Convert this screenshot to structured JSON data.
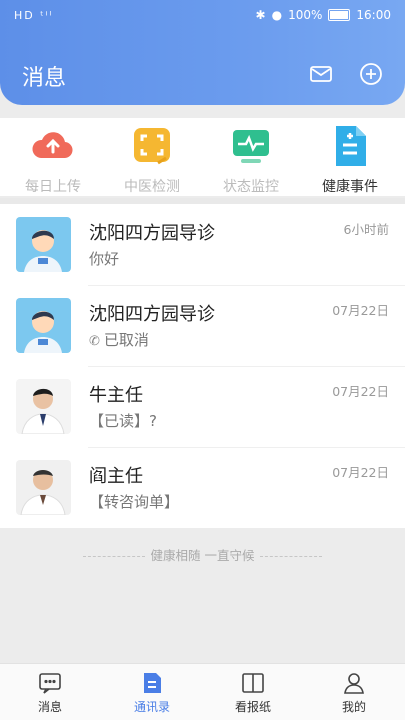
{
  "status_bar": {
    "left": "HD ᵗⁱˡ",
    "battery": "100%",
    "time": "16:00"
  },
  "header": {
    "title": "消息"
  },
  "features": [
    {
      "label": "每日上传",
      "icon": "cloud-upload-icon",
      "active": false
    },
    {
      "label": "中医检测",
      "icon": "scan-icon",
      "active": false
    },
    {
      "label": "状态监控",
      "icon": "monitor-icon",
      "active": false
    },
    {
      "label": "健康事件",
      "icon": "document-add-icon",
      "active": true
    }
  ],
  "conversations": [
    {
      "name": "沈阳四方园导诊",
      "message": "你好",
      "time": "6小时前",
      "avatar": "cartoon-doctor",
      "call_icon": false
    },
    {
      "name": "沈阳四方园导诊",
      "message": "已取消",
      "time": "07月22日",
      "avatar": "cartoon-doctor",
      "call_icon": true
    },
    {
      "name": "牛主任",
      "message": "【已读】?",
      "time": "07月22日",
      "avatar": "doctor-photo",
      "call_icon": false
    },
    {
      "name": "阎主任",
      "message": "【转咨询单】",
      "time": "07月22日",
      "avatar": "doctor-photo",
      "call_icon": false
    }
  ],
  "footer_tip": "健康相随 一直守候",
  "tabs": [
    {
      "label": "消息",
      "icon": "chat-icon",
      "active": false
    },
    {
      "label": "通讯录",
      "icon": "contacts-icon",
      "active": true
    },
    {
      "label": "看报纸",
      "icon": "book-icon",
      "active": false
    },
    {
      "label": "我的",
      "icon": "user-icon",
      "active": false
    }
  ],
  "colors": {
    "primary": "#5d8fe8",
    "tab_active": "#4a7ee6"
  }
}
